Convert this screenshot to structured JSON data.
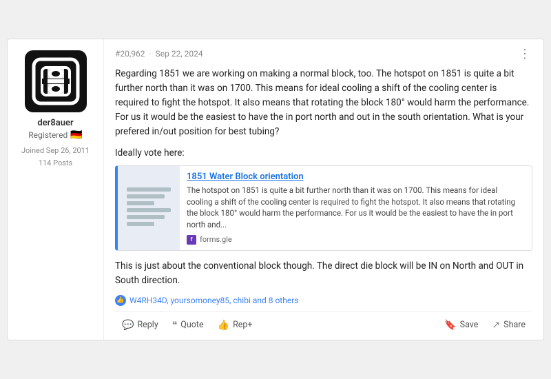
{
  "post": {
    "number": "#20,962",
    "date": "Sep 22, 2024",
    "body": "Regarding 1851 we are working on making a normal block, too. The hotspot on 1851 is quite a bit further north than it was on 1700. This means for ideal cooling a shift of the cooling center is required to fight the hotspot. It also means that rotating the block 180° would harm the performance. For us it would be the easiest to have the in port north and out in the south orientation. What is your prefered in/out position for best tubing?",
    "vote_text": "Ideally vote here:",
    "footer_text": "This is just about the conventional block though. The direct die block will be IN on North and OUT in South direction.",
    "likes": "W4RH34D, yoursomoney85, chibi and 8 others"
  },
  "author": {
    "username": "der8auer",
    "role": "Registered",
    "flag": "🇩🇪",
    "joined": "Joined Sep 26, 2011",
    "posts": "114 Posts"
  },
  "link_preview": {
    "title": "1851 Water Block orientation",
    "description": "The hotspot on 1851 is quite a bit further north than it was on 1700. This means for ideal cooling a shift of the cooling center is required to fight the hotspot. It also means that rotating the block 180° would harm the performance. For us it would be the easiest to have the in port north and...",
    "source": "forms.gle"
  },
  "actions": {
    "reply": "Reply",
    "quote": "Quote",
    "rep_plus": "Rep+",
    "save": "Save",
    "share": "Share"
  }
}
